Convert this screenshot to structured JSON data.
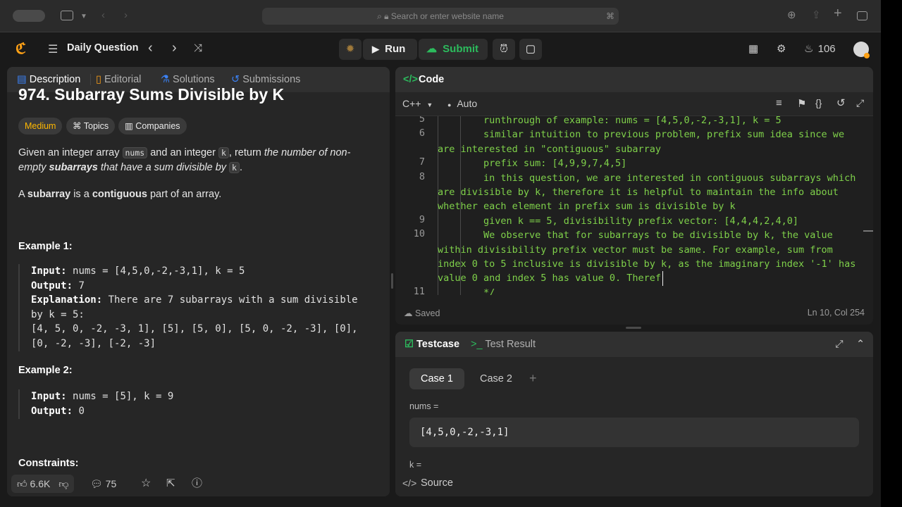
{
  "browser": {
    "url_placeholder": "Search or enter website name"
  },
  "nav": {
    "daily_question": "Daily Question",
    "run": "Run",
    "submit": "Submit",
    "streak": "106"
  },
  "left": {
    "tabs": [
      "Description",
      "Editorial",
      "Solutions",
      "Submissions"
    ],
    "title": "974. Subarray Sums Divisible by K",
    "difficulty": "Medium",
    "topics": "Topics",
    "companies": "Companies",
    "p1a": "Given an integer array",
    "p1_code1": "nums",
    "p1b": "and an integer",
    "p1_code2": "k",
    "p1c": ", return",
    "p1d": "the number of non-empty",
    "p1e": "subarrays",
    "p1f": "that have a sum divisible by",
    "p1_code3": "k",
    "p1g": ".",
    "p2a": "A",
    "p2b": "subarray",
    "p2c": "is a",
    "p2d": "contiguous",
    "p2e": "part of an array.",
    "ex1_title": "Example 1:",
    "ex1_input_label": "Input:",
    "ex1_input": "nums = [4,5,0,-2,-3,1], k = 5",
    "ex1_output_label": "Output:",
    "ex1_output": "7",
    "ex1_expl_label": "Explanation:",
    "ex1_expl1": "There are 7 subarrays with a sum divisible",
    "ex1_expl2": "by k = 5:",
    "ex1_expl3": "[4, 5, 0, -2, -3, 1], [5], [5, 0], [5, 0, -2, -3], [0],",
    "ex1_expl4": "[0, -2, -3], [-2, -3]",
    "ex2_title": "Example 2:",
    "ex2_input_label": "Input:",
    "ex2_input": "nums = [5], k = 9",
    "ex2_output_label": "Output:",
    "ex2_output": "0",
    "constraints": "Constraints:",
    "likes": "6.6K",
    "comments": "75"
  },
  "code": {
    "header": "Code",
    "lang": "C++",
    "mode": "Auto",
    "lines": [
      {
        "n": "5",
        "t": "        runthrough of example: nums = [4,5,0,-2,-3,1], k = 5"
      },
      {
        "n": "6",
        "t": "        similar intuition to previous problem, prefix sum idea since we"
      },
      {
        "n": "",
        "t": "are interested in \"contiguous\" subarray"
      },
      {
        "n": "7",
        "t": "        prefix sum: [4,9,9,7,4,5]"
      },
      {
        "n": "8",
        "t": "        in this question, we are interested in contiguous subarrays which"
      },
      {
        "n": "",
        "t": "are divisible by k, therefore it is helpful to maintain the info about"
      },
      {
        "n": "",
        "t": "whether each element in prefix sum is divisible by k"
      },
      {
        "n": "9",
        "t": "        given k == 5, divisibility prefix vector: [4,4,4,2,4,0]"
      },
      {
        "n": "10",
        "t": "        We observe that for subarrays to be divisible by k, the value"
      },
      {
        "n": "",
        "t": "within divisibility prefix vector must be same. For example, sum from"
      },
      {
        "n": "",
        "t": "index 0 to 5 inclusive is divisible by k, as the imaginary index '-1' has"
      },
      {
        "n": "",
        "t": "value 0 and index 5 has value 0. Theref"
      },
      {
        "n": "11",
        "t": "        */"
      }
    ],
    "saved": "Saved",
    "cursor": "Ln 10, Col 254"
  },
  "testcase": {
    "tab1": "Testcase",
    "tab2": "Test Result",
    "case1": "Case 1",
    "case2": "Case 2",
    "nums_label": "nums =",
    "nums_value": "[4,5,0,-2,-3,1]",
    "k_label": "k =",
    "source": "Source"
  },
  "colors": {
    "accent_green": "#2cbb5d",
    "medium": "#ffb800",
    "comment": "#7fd14a"
  }
}
